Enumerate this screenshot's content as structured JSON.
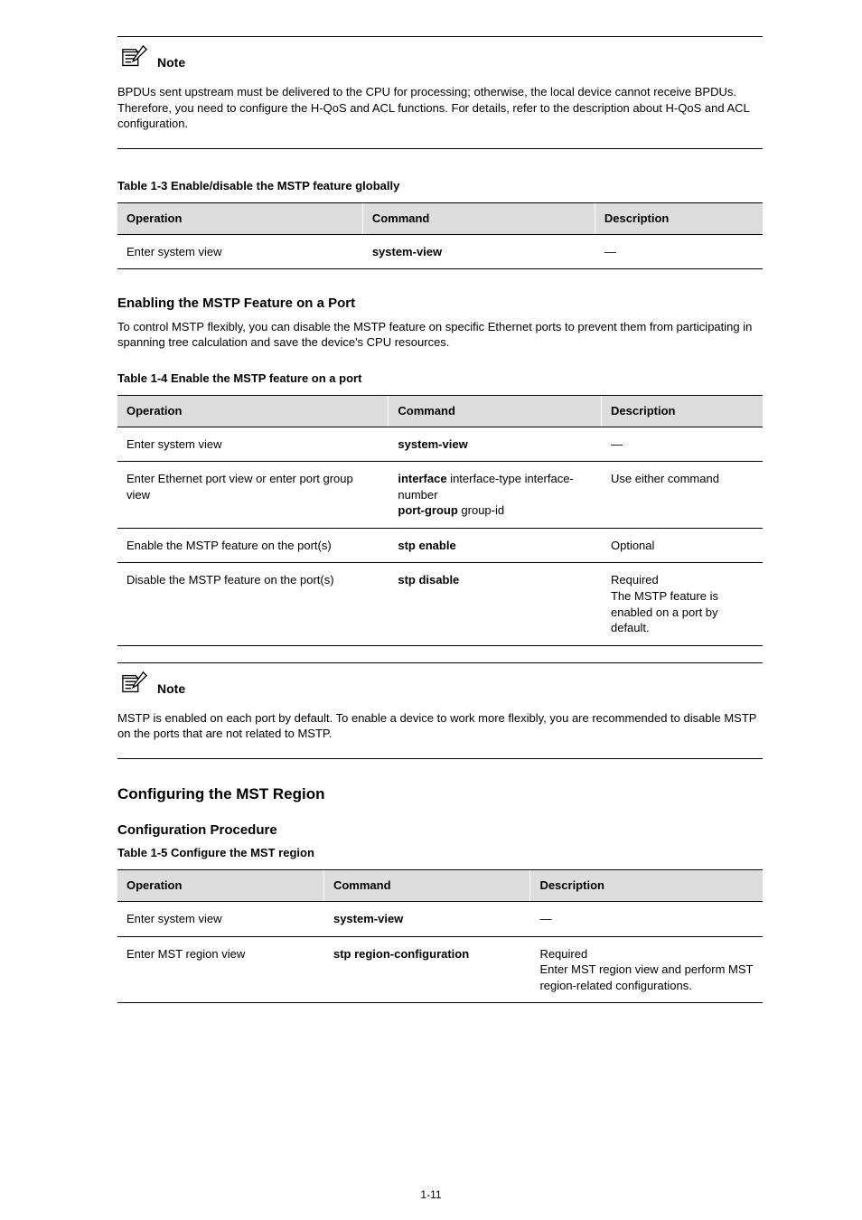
{
  "note1": {
    "label": "Note",
    "body": "BPDUs sent upstream must be delivered to the CPU for processing; otherwise, the local device cannot receive BPDUs. Therefore, you need to configure the H-QoS and ACL functions. For details, refer to the description about H-QoS and ACL configuration."
  },
  "table1": {
    "caption": "Table 1-3 Enable/disable the MSTP feature globally",
    "headers": [
      "Operation",
      "Command",
      "Description"
    ],
    "rows": [
      {
        "op": "Enter system view",
        "cmd": "system-view",
        "desc": "—"
      }
    ]
  },
  "sectionHeading1": "Enabling the MSTP Feature on a Port",
  "para1": "To control MSTP flexibly, you can disable the MSTP feature on specific Ethernet ports to prevent them from participating in spanning tree calculation and save the device's CPU resources.",
  "table2": {
    "caption": "Table 1-4 Enable the MSTP feature on a port",
    "headers": [
      "Operation",
      "Command",
      "Description"
    ],
    "rows": [
      {
        "op": "Enter system view",
        "cmd": "system-view",
        "desc": "—"
      },
      {
        "op": "Enter Ethernet port view or enter port group view",
        "cmd_a": "interface",
        "cmd_b": " interface-type interface-number",
        "cmd_c": "port-group",
        "cmd_d": " group-id",
        "desc": "Use either command"
      },
      {
        "op": "Enable the MSTP feature on the port(s)",
        "cmd_a": "stp enable",
        "desc": "Optional"
      },
      {
        "op": "Disable the MSTP feature on the port(s)",
        "cmd_a": "stp disable",
        "desc": "Required\nThe MSTP feature is enabled on a port by default."
      }
    ]
  },
  "note2": {
    "label": "Note",
    "body": "MSTP is enabled on each port by default. To enable a device to work more flexibly, you are recommended to disable MSTP on the ports that are not related to MSTP."
  },
  "heading2": "Configuring the MST Region",
  "sectionHeading2": "Configuration Procedure",
  "table3": {
    "caption": "Table 1-5 Configure the MST region",
    "headers": [
      "Operation",
      "Command",
      "Description"
    ],
    "rows": [
      {
        "op": "Enter system view",
        "cmd": "system-view",
        "desc": "—"
      },
      {
        "op": "Enter MST region view",
        "cmd": "stp region-configuration",
        "desc": "Required\nEnter MST region view and perform MST region-related configurations."
      }
    ]
  },
  "pageNumber": "1-11"
}
